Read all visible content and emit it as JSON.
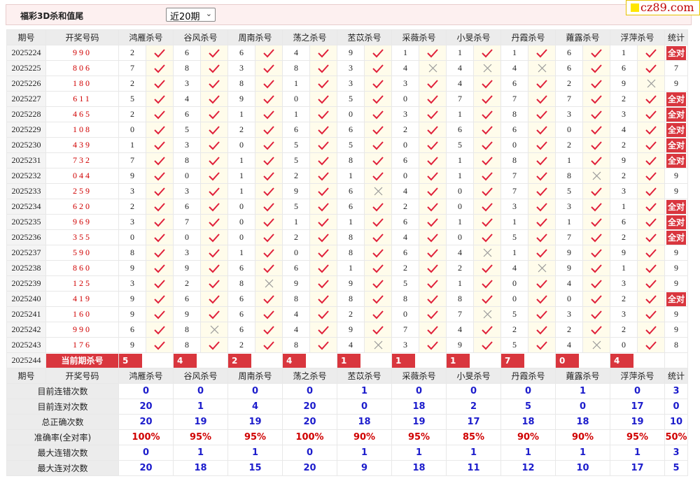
{
  "header": {
    "title": "福彩3D杀和值尾",
    "period_select": "近20期"
  },
  "site_logo": "cz89.com",
  "colors": {
    "accent_red": "#d9363e",
    "value_blue": "#1c1ccc",
    "tick_red": "#e0203a",
    "cross_gray": "#999999"
  },
  "columns": {
    "period": "期号",
    "draw": "开奖号码",
    "experts": [
      "鸿雁杀号",
      "谷风杀号",
      "周南杀号",
      "荡之杀号",
      "苤苡杀号",
      "采薇杀号",
      "小旻杀号",
      "丹霞杀号",
      "蕹露杀号",
      "浮萍杀号"
    ],
    "stats": "统计"
  },
  "all_correct_label": "全对",
  "rows": [
    {
      "period": "2025224",
      "draw": "990",
      "kills": [
        "2",
        "6",
        "6",
        "4",
        "9",
        "1",
        "1",
        "1",
        "6",
        "1"
      ],
      "res": [
        1,
        1,
        1,
        1,
        1,
        1,
        1,
        1,
        1,
        1
      ],
      "stat": "全对"
    },
    {
      "period": "2025225",
      "draw": "806",
      "kills": [
        "7",
        "8",
        "3",
        "8",
        "3",
        "4",
        "4",
        "4",
        "6",
        "6"
      ],
      "res": [
        1,
        1,
        1,
        1,
        1,
        0,
        0,
        0,
        1,
        1
      ],
      "stat": "7"
    },
    {
      "period": "2025226",
      "draw": "180",
      "kills": [
        "2",
        "3",
        "8",
        "1",
        "3",
        "3",
        "4",
        "6",
        "2",
        "9"
      ],
      "res": [
        1,
        1,
        1,
        1,
        1,
        1,
        1,
        1,
        1,
        0
      ],
      "stat": "9"
    },
    {
      "period": "2025227",
      "draw": "611",
      "kills": [
        "5",
        "4",
        "9",
        "0",
        "5",
        "0",
        "7",
        "7",
        "7",
        "2"
      ],
      "res": [
        1,
        1,
        1,
        1,
        1,
        1,
        1,
        1,
        1,
        1
      ],
      "stat": "全对"
    },
    {
      "period": "2025228",
      "draw": "465",
      "kills": [
        "2",
        "6",
        "1",
        "1",
        "0",
        "3",
        "1",
        "8",
        "3",
        "3"
      ],
      "res": [
        1,
        1,
        1,
        1,
        1,
        1,
        1,
        1,
        1,
        1
      ],
      "stat": "全对"
    },
    {
      "period": "2025229",
      "draw": "108",
      "kills": [
        "0",
        "5",
        "2",
        "6",
        "6",
        "2",
        "6",
        "6",
        "0",
        "4"
      ],
      "res": [
        1,
        1,
        1,
        1,
        1,
        1,
        1,
        1,
        1,
        1
      ],
      "stat": "全对"
    },
    {
      "period": "2025230",
      "draw": "439",
      "kills": [
        "1",
        "3",
        "0",
        "5",
        "5",
        "0",
        "5",
        "0",
        "2",
        "2"
      ],
      "res": [
        1,
        1,
        1,
        1,
        1,
        1,
        1,
        1,
        1,
        1
      ],
      "stat": "全对"
    },
    {
      "period": "2025231",
      "draw": "732",
      "kills": [
        "7",
        "8",
        "1",
        "5",
        "8",
        "6",
        "1",
        "8",
        "1",
        "9"
      ],
      "res": [
        1,
        1,
        1,
        1,
        1,
        1,
        1,
        1,
        1,
        1
      ],
      "stat": "全对"
    },
    {
      "period": "2025232",
      "draw": "044",
      "kills": [
        "9",
        "0",
        "1",
        "2",
        "1",
        "0",
        "1",
        "7",
        "8",
        "2"
      ],
      "res": [
        1,
        1,
        1,
        1,
        1,
        1,
        1,
        1,
        0,
        1
      ],
      "stat": "9"
    },
    {
      "period": "2025233",
      "draw": "259",
      "kills": [
        "3",
        "3",
        "1",
        "9",
        "6",
        "4",
        "0",
        "7",
        "5",
        "3"
      ],
      "res": [
        1,
        1,
        1,
        1,
        0,
        1,
        1,
        1,
        1,
        1
      ],
      "stat": "9"
    },
    {
      "period": "2025234",
      "draw": "620",
      "kills": [
        "2",
        "6",
        "0",
        "5",
        "6",
        "2",
        "0",
        "3",
        "3",
        "1"
      ],
      "res": [
        1,
        1,
        1,
        1,
        1,
        1,
        1,
        1,
        1,
        1
      ],
      "stat": "全对"
    },
    {
      "period": "2025235",
      "draw": "969",
      "kills": [
        "3",
        "7",
        "0",
        "1",
        "1",
        "6",
        "1",
        "1",
        "1",
        "6"
      ],
      "res": [
        1,
        1,
        1,
        1,
        1,
        1,
        1,
        1,
        1,
        1
      ],
      "stat": "全对"
    },
    {
      "period": "2025236",
      "draw": "355",
      "kills": [
        "0",
        "0",
        "0",
        "2",
        "8",
        "4",
        "0",
        "5",
        "7",
        "2"
      ],
      "res": [
        1,
        1,
        1,
        1,
        1,
        1,
        1,
        1,
        1,
        1
      ],
      "stat": "全对"
    },
    {
      "period": "2025237",
      "draw": "590",
      "kills": [
        "8",
        "3",
        "1",
        "0",
        "8",
        "6",
        "4",
        "1",
        "9",
        "9"
      ],
      "res": [
        1,
        1,
        1,
        1,
        1,
        1,
        0,
        1,
        1,
        1
      ],
      "stat": "9"
    },
    {
      "period": "2025238",
      "draw": "860",
      "kills": [
        "9",
        "9",
        "6",
        "6",
        "1",
        "2",
        "2",
        "4",
        "9",
        "1"
      ],
      "res": [
        1,
        1,
        1,
        1,
        1,
        1,
        1,
        0,
        1,
        1
      ],
      "stat": "9"
    },
    {
      "period": "2025239",
      "draw": "125",
      "kills": [
        "3",
        "2",
        "8",
        "9",
        "9",
        "5",
        "1",
        "0",
        "4",
        "3"
      ],
      "res": [
        1,
        1,
        0,
        1,
        1,
        1,
        1,
        1,
        1,
        1
      ],
      "stat": "9"
    },
    {
      "period": "2025240",
      "draw": "419",
      "kills": [
        "9",
        "6",
        "6",
        "8",
        "8",
        "8",
        "8",
        "0",
        "0",
        "2"
      ],
      "res": [
        1,
        1,
        1,
        1,
        1,
        1,
        1,
        1,
        1,
        1
      ],
      "stat": "全对"
    },
    {
      "period": "2025241",
      "draw": "160",
      "kills": [
        "9",
        "9",
        "6",
        "4",
        "2",
        "0",
        "7",
        "5",
        "3",
        "3"
      ],
      "res": [
        1,
        1,
        1,
        1,
        1,
        1,
        0,
        1,
        1,
        1
      ],
      "stat": "9"
    },
    {
      "period": "2025242",
      "draw": "990",
      "kills": [
        "6",
        "8",
        "6",
        "4",
        "9",
        "7",
        "4",
        "2",
        "2",
        "2"
      ],
      "res": [
        1,
        0,
        1,
        1,
        1,
        1,
        1,
        1,
        1,
        1
      ],
      "stat": "9"
    },
    {
      "period": "2025243",
      "draw": "176",
      "kills": [
        "9",
        "8",
        "2",
        "8",
        "4",
        "3",
        "9",
        "5",
        "4",
        "0"
      ],
      "res": [
        1,
        1,
        1,
        1,
        0,
        1,
        1,
        1,
        0,
        1
      ],
      "stat": "8"
    }
  ],
  "current": {
    "period": "2025244",
    "label": "当前期杀号",
    "kills": [
      "5",
      "4",
      "2",
      "4",
      "1",
      "1",
      "1",
      "7",
      "0",
      "4"
    ]
  },
  "summary": [
    {
      "label": "目前连错次数",
      "values": [
        "0",
        "0",
        "0",
        "0",
        "1",
        "0",
        "0",
        "0",
        "1",
        "0",
        "3"
      ]
    },
    {
      "label": "目前连对次数",
      "values": [
        "20",
        "1",
        "4",
        "20",
        "0",
        "18",
        "2",
        "5",
        "0",
        "17",
        "0"
      ]
    },
    {
      "label": "总正确次数",
      "values": [
        "20",
        "19",
        "19",
        "20",
        "18",
        "19",
        "17",
        "18",
        "18",
        "19",
        "10"
      ]
    },
    {
      "label": "准确率(全对率)",
      "values": [
        "100%",
        "95%",
        "95%",
        "100%",
        "90%",
        "95%",
        "85%",
        "90%",
        "90%",
        "95%",
        "50%"
      ],
      "red": true
    },
    {
      "label": "最大连错次数",
      "values": [
        "0",
        "1",
        "1",
        "0",
        "1",
        "1",
        "1",
        "1",
        "1",
        "1",
        "3"
      ]
    },
    {
      "label": "最大连对次数",
      "values": [
        "20",
        "18",
        "15",
        "20",
        "9",
        "18",
        "11",
        "12",
        "10",
        "17",
        "5"
      ]
    }
  ]
}
